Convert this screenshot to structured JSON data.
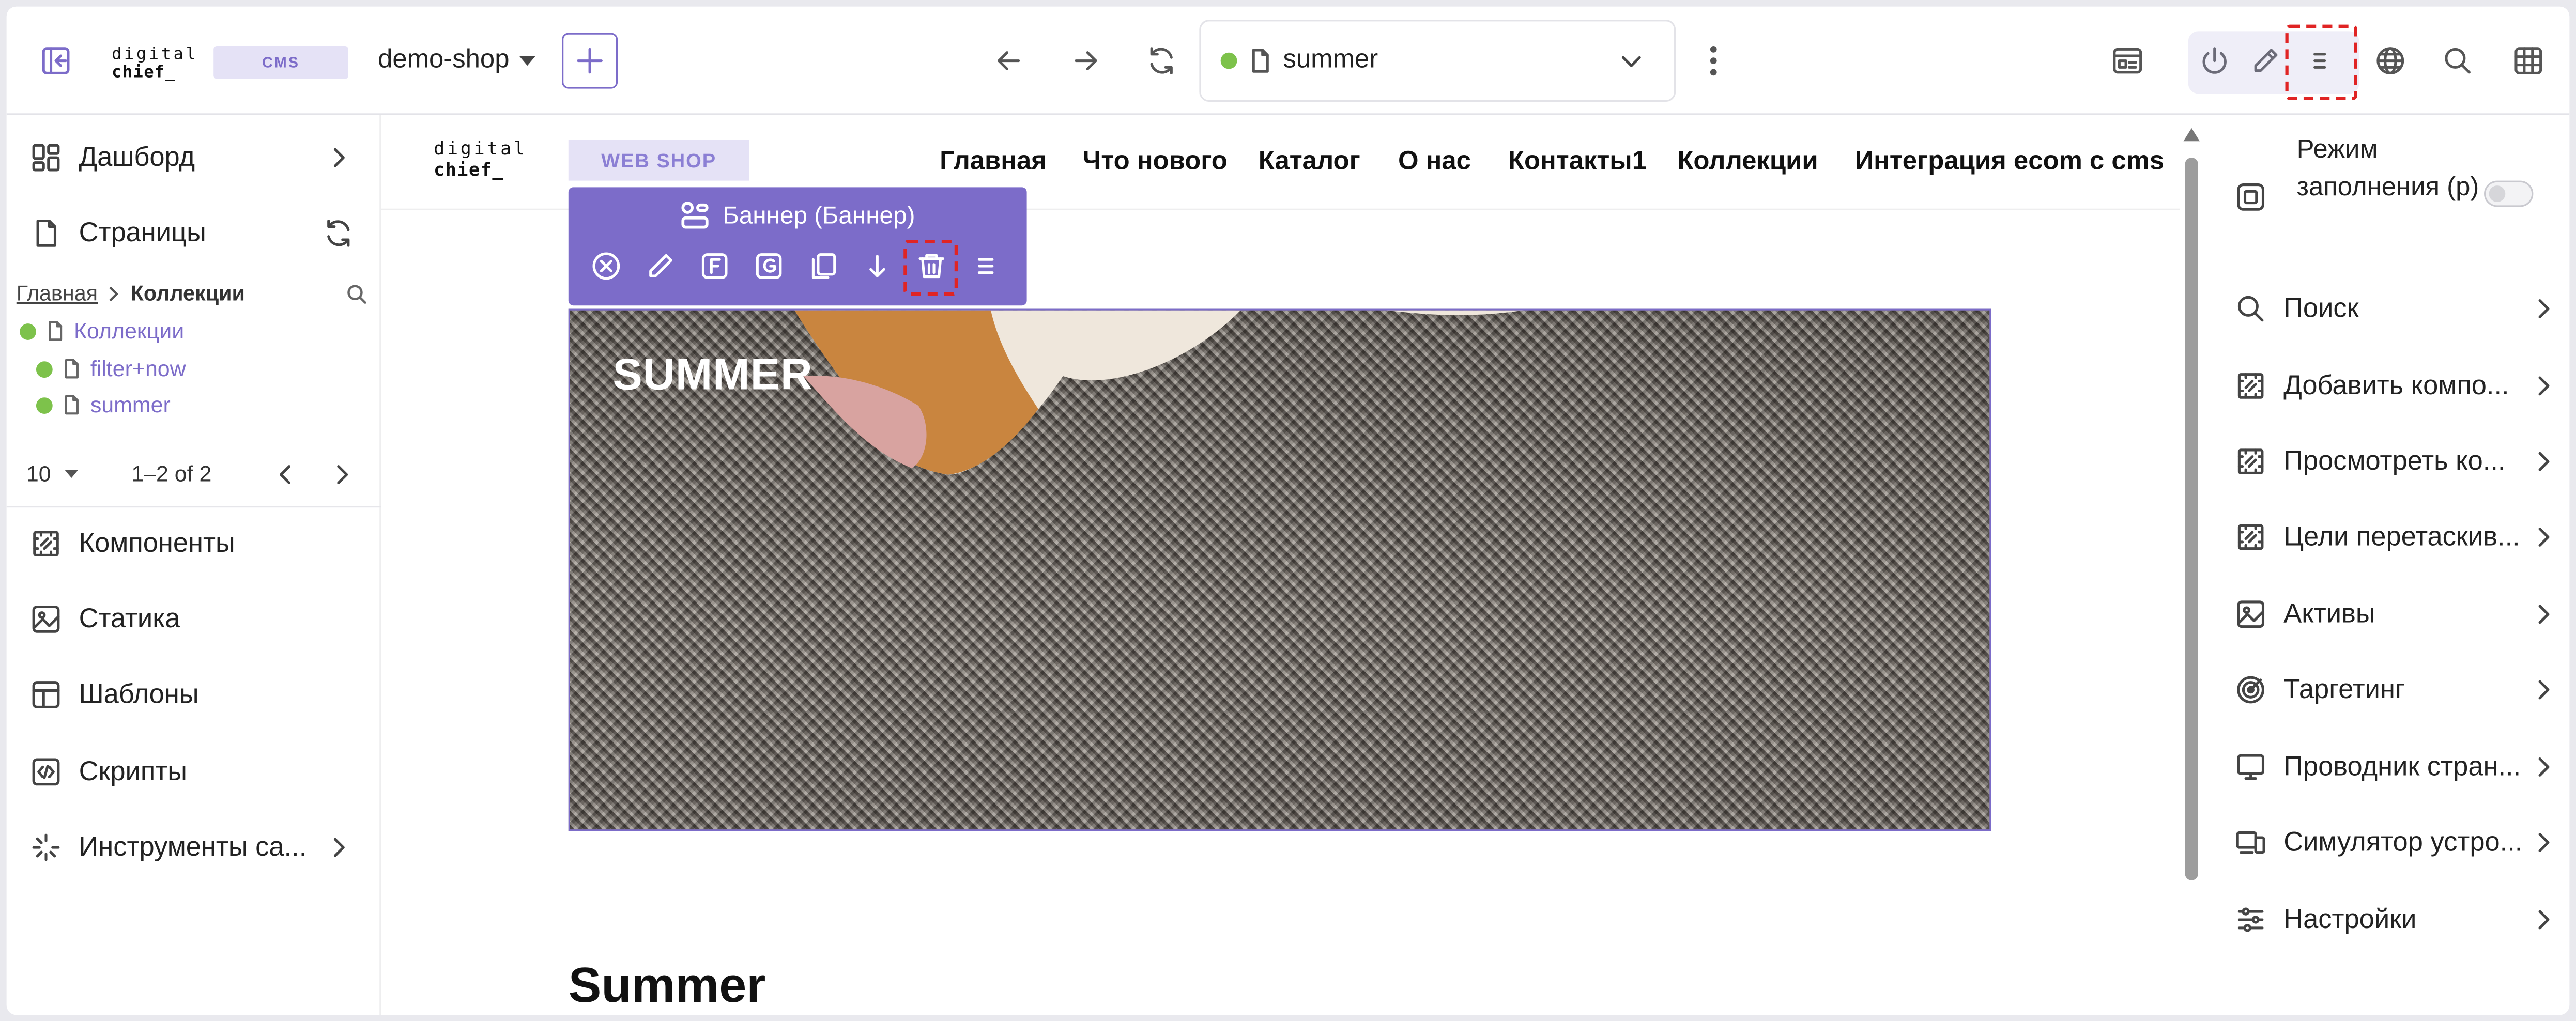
{
  "topbar": {
    "logo_line1": "digital",
    "logo_line2": "chief_",
    "cms_badge": "CMS",
    "site_selector": "demo-shop",
    "address": "summer"
  },
  "leftbar": {
    "nav_top": [
      {
        "label": "Дашборд",
        "icon": "dashboard-icon"
      },
      {
        "label": "Страницы",
        "icon": "page-icon"
      }
    ],
    "breadcrumb": {
      "root": "Главная",
      "current": "Коллекции"
    },
    "tree": [
      {
        "label": "Коллекции",
        "status_color": "#7dc24b"
      },
      {
        "label": "filter+now",
        "status_color": "#7dc24b"
      },
      {
        "label": "summer",
        "status_color": "#7dc24b"
      }
    ],
    "pager": {
      "page_size": "10",
      "range": "1–2 of 2"
    },
    "nav_bottom": [
      {
        "label": "Компоненты",
        "icon": "component-icon"
      },
      {
        "label": "Статика",
        "icon": "image-icon"
      },
      {
        "label": "Шаблоны",
        "icon": "template-icon"
      },
      {
        "label": "Скрипты",
        "icon": "script-icon"
      },
      {
        "label": "Инструменты са...",
        "icon": "tools-icon"
      }
    ]
  },
  "site": {
    "logo_line1": "digital",
    "logo_line2": "chief_",
    "webshop_badge": "WEB SHOP",
    "nav": [
      "Главная",
      "Что нового",
      "Каталог",
      "О нас",
      "Контакты1",
      "Коллекции",
      "Интеграция ecom с cms"
    ],
    "component_toolbar": {
      "title": "Баннер (Баннер)",
      "actions": [
        "close-icon",
        "edit-icon",
        "f-icon",
        "g-icon",
        "copy-icon",
        "move-down-icon",
        "delete-icon",
        "menu-icon"
      ]
    },
    "banner_title": "SUMMER",
    "page_heading": "Summer"
  },
  "rightbar": {
    "fill_mode_label": "Режим заполнения (p)",
    "fill_mode_on": false,
    "items": [
      {
        "label": "Поиск",
        "icon": "search-icon"
      },
      {
        "label": "Добавить компо...",
        "icon": "component-icon"
      },
      {
        "label": "Просмотреть ко...",
        "icon": "component-icon"
      },
      {
        "label": "Цели перетаскив...",
        "icon": "component-icon"
      },
      {
        "label": "Активы",
        "icon": "image-icon"
      },
      {
        "label": "Таргетинг",
        "icon": "target-icon"
      },
      {
        "label": "Проводник стран...",
        "icon": "monitor-icon"
      },
      {
        "label": "Симулятор устро...",
        "icon": "devices-icon"
      },
      {
        "label": "Настройки",
        "icon": "settings-icon"
      }
    ]
  },
  "colors": {
    "accent": "#7c6cc9",
    "status_green": "#7dc24b",
    "highlight_red": "#e02424"
  }
}
